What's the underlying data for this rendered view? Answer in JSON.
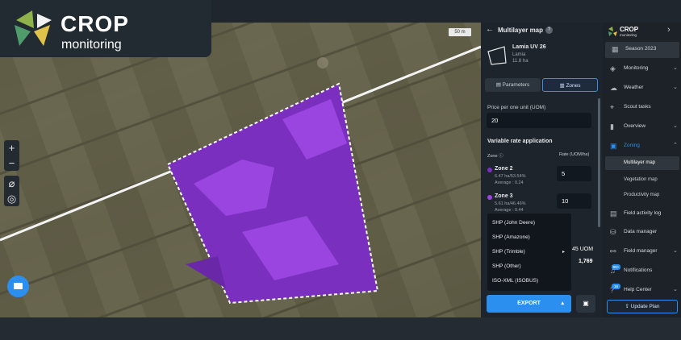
{
  "brand": {
    "title": "CROP",
    "subtitle": "monitoring",
    "sidebar_title": "CROP",
    "sidebar_subtitle": "monitoring"
  },
  "map": {
    "scale_label": "50 m",
    "zoom_in": "+",
    "zoom_out": "−"
  },
  "panel": {
    "title": "Multilayer map",
    "field": {
      "name": "Lamia UV 26",
      "location": "Lamia",
      "area": "11.8 ha"
    },
    "tabs": [
      {
        "label": "Parameters"
      },
      {
        "label": "Zones"
      }
    ],
    "price_label": "Price per one unit (UOM)",
    "price_value": "20",
    "section_title": "Variable rate application",
    "col_zone": "Zone",
    "col_rate": "Rate (UOM/ha)",
    "zones": [
      {
        "name": "Zone 2",
        "meta": "6.47 ha/53.54%",
        "average": "Average : 0.24",
        "rate": "5",
        "color": "#7b2fbf"
      },
      {
        "name": "Zone 3",
        "meta": "5.61 ha/46.46%",
        "average": "Average : 0.44",
        "rate": "10",
        "color": "#9b45e0"
      }
    ],
    "total_uom": "45 UOM",
    "total_cost": "1,769",
    "export_label": "EXPORT",
    "export_options": [
      "SHP (John Deere)",
      "SHP (Amazone)",
      "SHP (Trimble)",
      "SHP (Other)",
      "ISO-XML (ISOBUS)"
    ]
  },
  "sidebar": {
    "season": "Season 2023",
    "items": [
      {
        "label": "Monitoring",
        "icon": "layers-icon"
      },
      {
        "label": "Weather",
        "icon": "cloud-icon"
      },
      {
        "label": "Scout tasks",
        "icon": "pin-icon"
      },
      {
        "label": "Overview",
        "icon": "chart-icon"
      },
      {
        "label": "Zoning",
        "icon": "zoning-icon"
      }
    ],
    "zoning_sub": [
      "Multilayer map",
      "Vegetation map",
      "Productivity map"
    ],
    "items2": [
      {
        "label": "Field activity log",
        "icon": "log-icon"
      },
      {
        "label": "Data manager",
        "icon": "database-icon"
      },
      {
        "label": "Field manager",
        "icon": "network-icon"
      },
      {
        "label": "Notifications",
        "icon": "bell-icon",
        "badge": "99+"
      },
      {
        "label": "Help Center",
        "icon": "help-icon",
        "badge": "16"
      }
    ],
    "update_plan": "Update Plan"
  },
  "colors": {
    "accent": "#2b8ff0",
    "zone_dark": "#7b2fbf",
    "zone_light": "#9b45e0"
  }
}
